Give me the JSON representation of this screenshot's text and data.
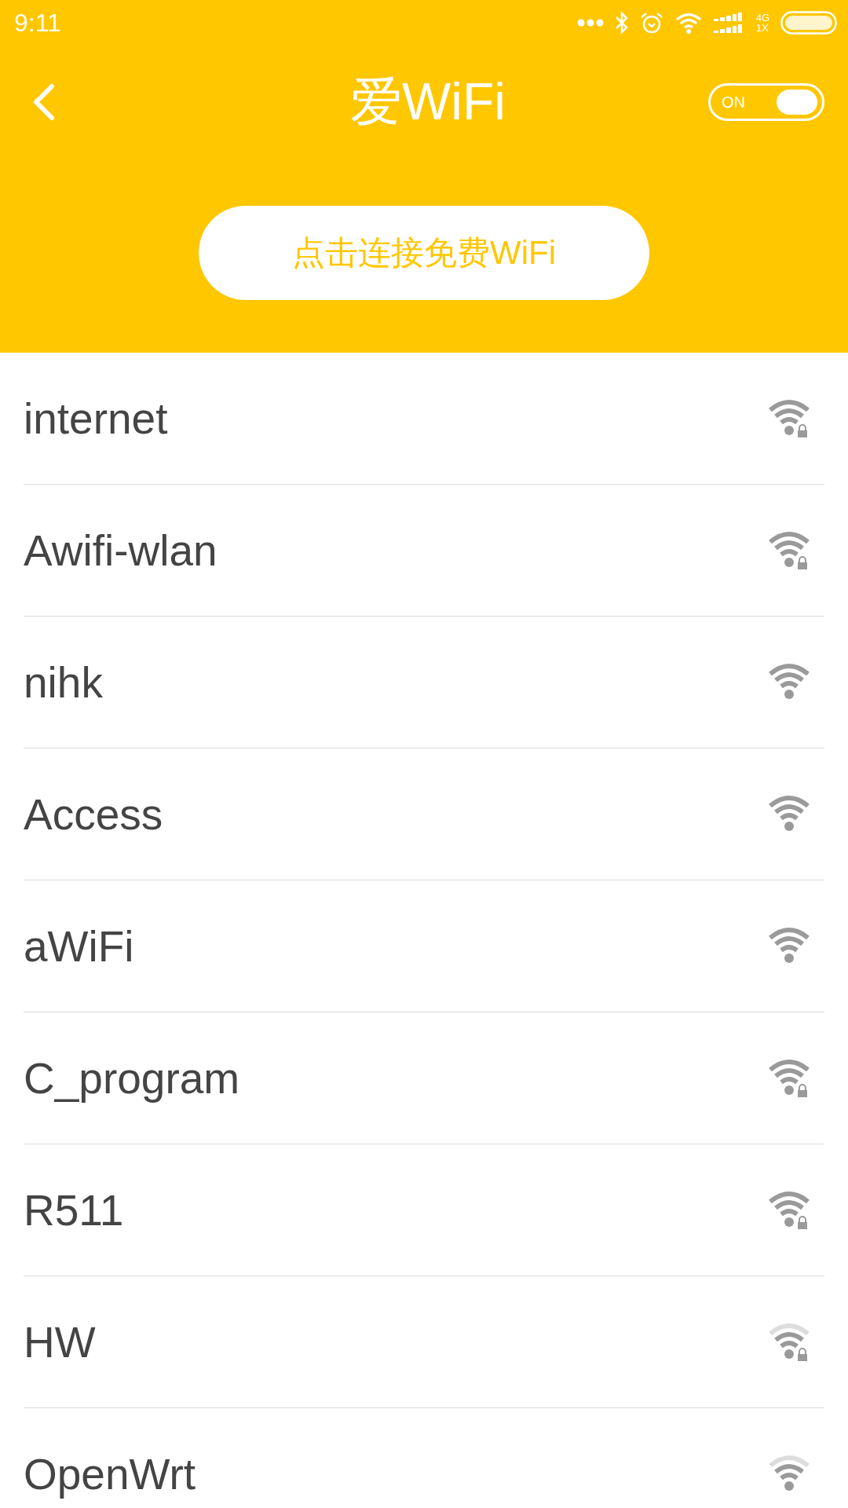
{
  "status_bar": {
    "time": "9:11",
    "network_top": "4G",
    "network_bottom": "1X"
  },
  "header": {
    "title": "爱WiFi",
    "toggle": {
      "label": "ON",
      "on": true
    }
  },
  "connect_button": {
    "label": "点击连接免费WiFi"
  },
  "networks": [
    {
      "name": "internet",
      "locked": true,
      "kind": "strong"
    },
    {
      "name": "Awifi-wlan",
      "locked": true,
      "kind": "strong"
    },
    {
      "name": "nihk",
      "locked": false,
      "kind": "strong"
    },
    {
      "name": "Access",
      "locked": false,
      "kind": "strong"
    },
    {
      "name": "aWiFi",
      "locked": false,
      "kind": "strong"
    },
    {
      "name": "C_program",
      "locked": true,
      "kind": "strong"
    },
    {
      "name": "R511",
      "locked": true,
      "kind": "strong"
    },
    {
      "name": "HW",
      "locked": true,
      "kind": "medium"
    },
    {
      "name": "OpenWrt",
      "locked": false,
      "kind": "medium"
    }
  ]
}
